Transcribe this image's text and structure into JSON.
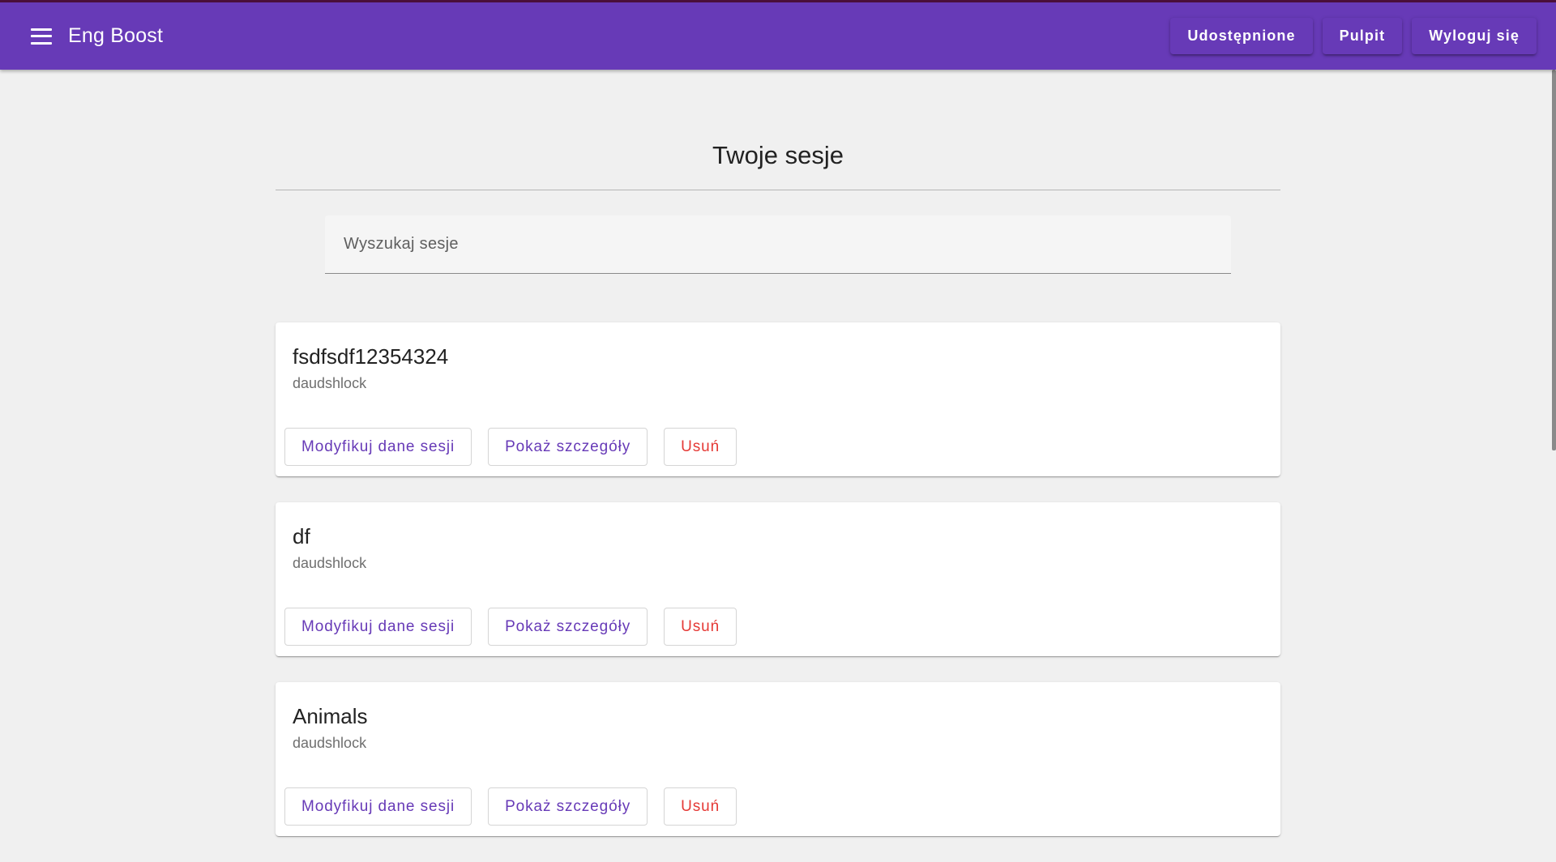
{
  "header": {
    "menu_icon": "menu-icon",
    "app_title": "Eng Boost",
    "nav": [
      {
        "label": "Udostępnione"
      },
      {
        "label": "Pulpit"
      },
      {
        "label": "Wyloguj się"
      }
    ]
  },
  "main": {
    "title": "Twoje sesje",
    "search": {
      "placeholder": "Wyszukaj sesje",
      "value": ""
    },
    "sessions": [
      {
        "name": "fsdfsdf12354324",
        "owner": "daudshlock",
        "actions": {
          "edit": "Modyfikuj dane sesji",
          "details": "Pokaż szczegóły",
          "delete": "Usuń"
        }
      },
      {
        "name": "df",
        "owner": "daudshlock",
        "actions": {
          "edit": "Modyfikuj dane sesji",
          "details": "Pokaż szczegóły",
          "delete": "Usuń"
        }
      },
      {
        "name": "Animals",
        "owner": "daudshlock",
        "actions": {
          "edit": "Modyfikuj dane sesji",
          "details": "Pokaż szczegóły",
          "delete": "Usuń"
        }
      }
    ]
  },
  "colors": {
    "primary": "#673ab7",
    "warn": "#e53935",
    "background": "#f0f0f0"
  }
}
